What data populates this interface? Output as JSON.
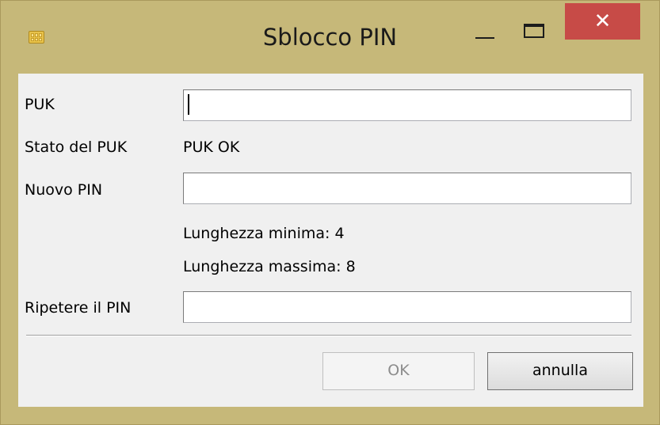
{
  "window": {
    "title": "Sblocco PIN",
    "close_symbol": "✕",
    "colors": {
      "frame": "#c6b879",
      "close_button": "#c74b47",
      "client_background": "#f0f0f0"
    },
    "icons": {
      "app": "smartcard-chip-icon",
      "minimize": "minimize-icon",
      "maximize": "maximize-icon",
      "close": "close-icon"
    }
  },
  "form": {
    "puk": {
      "label": "PUK",
      "value": "",
      "focused": true
    },
    "puk_status": {
      "label": "Stato del PUK",
      "value": "PUK OK"
    },
    "new_pin": {
      "label": "Nuovo PIN",
      "value": ""
    },
    "min_length_text": "Lunghezza minima: 4",
    "max_length_text": "Lunghezza massima: 8",
    "repeat_pin": {
      "label": "Ripetere il PIN",
      "value": ""
    }
  },
  "buttons": {
    "ok_label": "OK",
    "ok_enabled": false,
    "cancel_label": "annulla"
  }
}
